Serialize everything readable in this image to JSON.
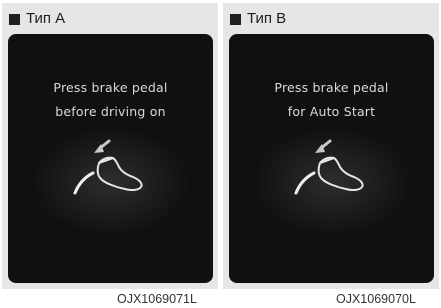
{
  "panels": [
    {
      "type_label": "Тип A",
      "message_line1": "Press brake pedal",
      "message_line2": "before driving on",
      "icon": "brake-pedal-foot-icon",
      "image_code": "OJX1069071L"
    },
    {
      "type_label": "Тип B",
      "message_line1": "Press brake pedal",
      "message_line2": "for Auto Start",
      "icon": "brake-pedal-foot-icon",
      "image_code": "OJX1069070L"
    }
  ],
  "colors": {
    "screen_background": "#101010",
    "screen_text": "#d9d9d9",
    "icon_stroke": "#e6e6e6",
    "panel_background": "#e6e6e6"
  }
}
